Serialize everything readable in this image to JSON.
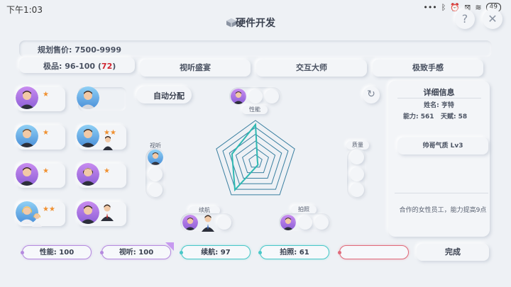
{
  "status_bar": {
    "time": "下午1:03",
    "icons": [
      "dots-icon",
      "bluetooth-icon",
      "alarm-icon",
      "sim-icon",
      "wifi-icon",
      "battery-icon"
    ],
    "battery": "49"
  },
  "header": {
    "title": "硬件开发",
    "help": "?",
    "close": "✕"
  },
  "pricing": {
    "planned_price": "规划售价: 7500-9999",
    "rare_prefix": "极品: 96-100 (",
    "rare_value": "72",
    "rare_suffix": ")"
  },
  "tabs": [
    "视听盛宴",
    "交互大师",
    "极致手感"
  ],
  "auto_assign": "自动分配",
  "radar": {
    "labels": {
      "performance": "性能",
      "audiovisual": "视听",
      "battery": "续航",
      "photo": "拍照",
      "quality": "质量"
    },
    "values": {
      "performance": 0.9,
      "quality": 0.05,
      "photo": 0.1,
      "battery": 0.85,
      "audiovisual": 0.6
    },
    "colors": {
      "grid": "#3a7fa0",
      "value": "#2fb8b2"
    }
  },
  "staff_stars": [
    "★",
    "",
    "★",
    "★★",
    "★",
    "★",
    "★★",
    ""
  ],
  "detail": {
    "title": "详细信息",
    "name": "姓名: 亨特",
    "ability": "能力: 561",
    "talent": "天赋: 58",
    "trait": "帅哥气质 Lv3",
    "description": "合作的女性员工，能力提高9点"
  },
  "stats": {
    "performance": "性能: 100",
    "audiovisual": "视听: 100",
    "battery": "续航: 97",
    "photo": "拍照: 61",
    "extra": ""
  },
  "stat_colors": {
    "performance": "#b58adf",
    "audiovisual": "#b58adf",
    "battery": "#48c8c8",
    "photo": "#48c8c8",
    "extra": "#e06a7a"
  },
  "finish": "完成"
}
